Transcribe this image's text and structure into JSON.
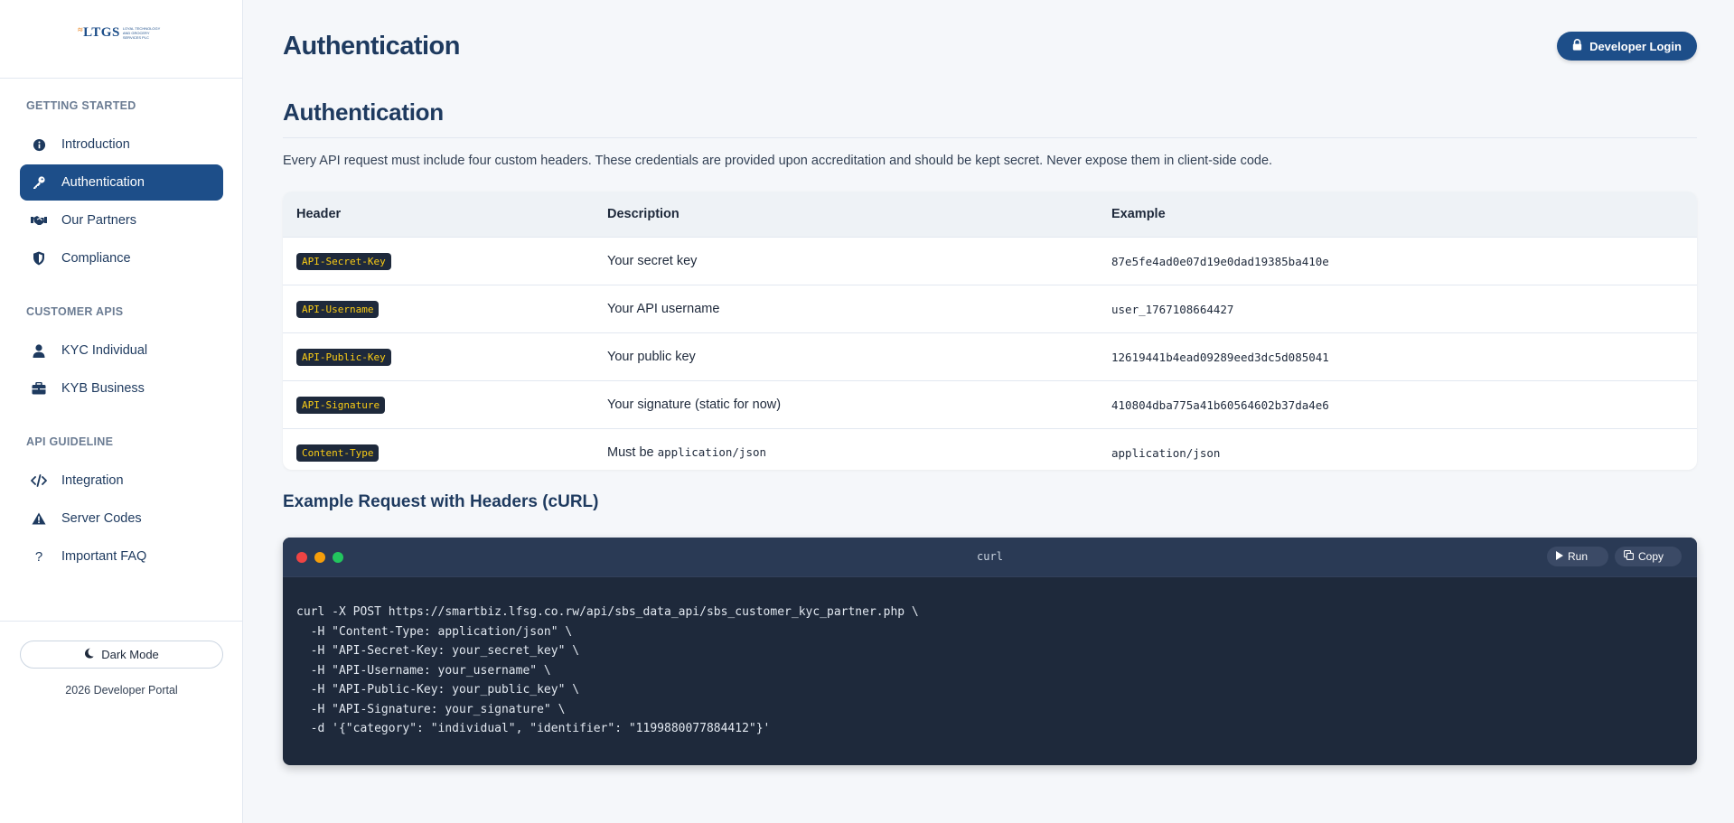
{
  "logo": {
    "text": "LTGS",
    "tagline": "LOYAL TECHNOLOGY AND GROCERY SERVICES PLC"
  },
  "sidebar": {
    "sections": [
      {
        "title": "GETTING STARTED"
      },
      {
        "title": "CUSTOMER APIS"
      },
      {
        "title": "API GUIDELINE"
      }
    ],
    "items": [
      {
        "label": "Introduction",
        "icon": "info-icon"
      },
      {
        "label": "Authentication",
        "icon": "key-icon",
        "active": true
      },
      {
        "label": "Our Partners",
        "icon": "handshake-icon"
      },
      {
        "label": "Compliance",
        "icon": "shield-icon"
      },
      {
        "label": "KYC Individual",
        "icon": "user-icon"
      },
      {
        "label": "KYB Business",
        "icon": "briefcase-icon"
      },
      {
        "label": "Integration",
        "icon": "code-icon"
      },
      {
        "label": "Server Codes",
        "icon": "warning-icon"
      },
      {
        "label": "Important FAQ",
        "icon": "question-icon"
      }
    ],
    "dark_mode_label": "Dark Mode",
    "footer": "2026 Developer Portal"
  },
  "header": {
    "title": "Authentication",
    "login_label": "Developer Login"
  },
  "content": {
    "section_title": "Authentication",
    "intro": "Every API request must include four custom headers. These credentials are provided upon accreditation and should be kept secret. Never expose them in client-side code.",
    "table": {
      "columns": [
        "Header",
        "Description",
        "Example"
      ],
      "rows": [
        {
          "header": "API-Secret-Key",
          "description": "Your secret key",
          "example": "87e5fe4ad0e07d19e0dad19385ba410e"
        },
        {
          "header": "API-Username",
          "description": "Your API username",
          "example": "user_1767108664427"
        },
        {
          "header": "API-Public-Key",
          "description": "Your public key",
          "example": "12619441b4ead09289eed3dc5d085041"
        },
        {
          "header": "API-Signature",
          "description": "Your signature (static for now)",
          "example": "410804dba775a41b60564602b37da4e6"
        },
        {
          "header": "Content-Type",
          "description_prefix": "Must be ",
          "description_code": "application/json",
          "example": "application/json"
        }
      ]
    },
    "example_title": "Example Request with Headers (cURL)",
    "code": {
      "lang": "curl",
      "run_label": "Run",
      "copy_label": "Copy",
      "body": "curl -X POST https://smartbiz.lfsg.co.rw/api/sbs_data_api/sbs_customer_kyc_partner.php \\\n  -H \"Content-Type: application/json\" \\\n  -H \"API-Secret-Key: your_secret_key\" \\\n  -H \"API-Username: your_username\" \\\n  -H \"API-Public-Key: your_public_key\" \\\n  -H \"API-Signature: your_signature\" \\\n  -d '{\"category\": \"individual\", \"identifier\": \"1199880077884412\"}'"
    }
  },
  "colors": {
    "primary": "#1d4e89",
    "badge_bg": "#1e293b",
    "badge_text": "#facc15",
    "code_bg": "#1e293b"
  }
}
